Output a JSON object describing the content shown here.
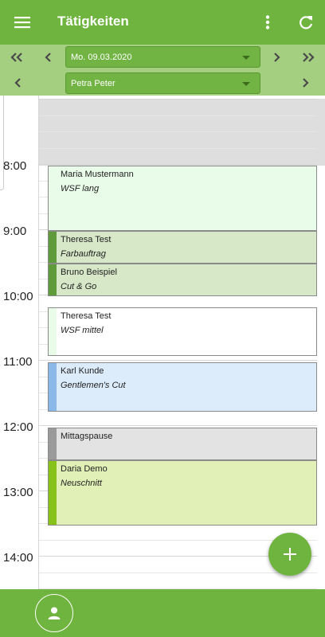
{
  "app": {
    "title": "Tätigkeiten"
  },
  "toolbar": {
    "menu_icon": "hamburger-menu-icon",
    "overflow_icon": "more-vertical-icon",
    "refresh_icon": "refresh-icon"
  },
  "nav": {
    "date_value": "Mo. 09.03.2020",
    "staff_value": "Petra Peter"
  },
  "calendar": {
    "hours": [
      "8:00",
      "9:00",
      "10:00",
      "11:00",
      "12:00",
      "13:00",
      "14:00"
    ],
    "events": [
      {
        "name": "Maria Mustermann",
        "service": "WSF lang",
        "color": "#e9fbe9",
        "bar_color": "#e9fbe9"
      },
      {
        "name": "Theresa Test",
        "service": "Farbauftrag",
        "color": "#d6e8c7",
        "bar_color": "#5f9b3a"
      },
      {
        "name": "Bruno Beispiel",
        "service": "Cut & Go",
        "color": "#d6e8c7",
        "bar_color": "#5f9b3a"
      },
      {
        "name": "Theresa Test",
        "service": "WSF mittel",
        "color": "#ffffff",
        "bar_color": "#e9fbe9"
      },
      {
        "name": "Karl Kunde",
        "service": "Gentlemen's Cut",
        "color": "#dcecfb",
        "bar_color": "#8ab8e8"
      },
      {
        "name": "Mittagspause",
        "service": "",
        "color": "#e3e3e3",
        "bar_color": "#9a9a9a"
      },
      {
        "name": "Daria Demo",
        "service": "Neuschnitt",
        "color": "#e1f0b6",
        "bar_color": "#86c21a"
      }
    ]
  },
  "fab": {
    "icon": "plus-icon"
  },
  "bottom_nav": {
    "icon": "person-icon"
  },
  "colors": {
    "primary": "#6fb43f",
    "nav_bar": "#a5cf80"
  }
}
